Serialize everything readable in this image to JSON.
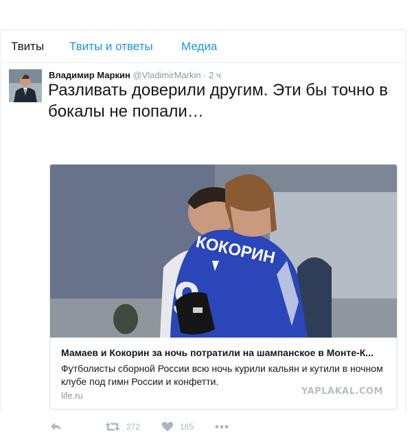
{
  "tabs": [
    {
      "label": "Твиты",
      "active": true
    },
    {
      "label": "Твиты и ответы",
      "active": false
    },
    {
      "label": "Медиа",
      "active": false
    }
  ],
  "tweet": {
    "author_name": "Владимир Маркин",
    "author_handle": "@VladimirMarkin",
    "separator": "·",
    "time": "2 ч",
    "text": "Разливать доверили другим. Эти бы точно в бокалы не попали…",
    "card": {
      "photo_shirt_text": "КОКОРИН",
      "title": "Мамаев и Кокорин за ночь потратили на шампанское в Монте-К...",
      "description": "Футболисты сборной России всю ночь курили кальян и кутили в ночном клубе под гимн России и конфетти.",
      "domain": "life.ru"
    },
    "actions": {
      "retweets": "272",
      "likes": "165"
    }
  },
  "watermark": "YAPLAKAL.COM",
  "colors": {
    "link": "#1b95e0",
    "muted": "#8899a6",
    "icon": "#aab8c2",
    "jersey": "#2a46b8"
  }
}
